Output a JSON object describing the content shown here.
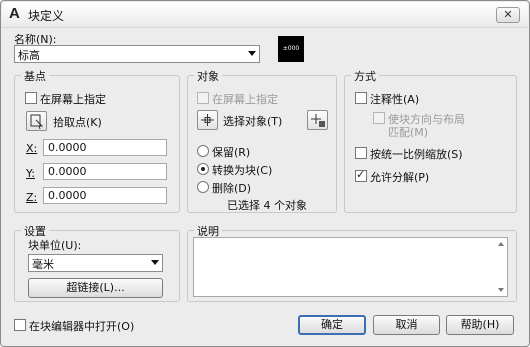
{
  "window": {
    "title": "块定义",
    "app_icon": "A",
    "close_label": "✕"
  },
  "name": {
    "label": "名称(N):",
    "value": "标高",
    "preview_text": "±000"
  },
  "base_point": {
    "title": "基点",
    "specify_on_screen": "在屏幕上指定",
    "pick_point": "拾取点(K)",
    "x_label": "X:",
    "x_value": "0.0000",
    "y_label": "Y:",
    "y_value": "0.0000",
    "z_label": "Z:",
    "z_value": "0.0000"
  },
  "objects": {
    "title": "对象",
    "specify_on_screen": "在屏幕上指定",
    "select_objects": "选择对象(T)",
    "retain": "保留(R)",
    "convert_to_block": "转换为块(C)",
    "delete": "删除(D)",
    "selected_count": "已选择 4 个对象"
  },
  "behavior": {
    "title": "方式",
    "annotative": "注释性(A)",
    "match_orientation_line1": "使块方向与布局",
    "match_orientation_line2": "匹配(M)",
    "scale_uniformly": "按统一比例缩放(S)",
    "allow_exploding": "允许分解(P)"
  },
  "settings": {
    "title": "设置",
    "block_unit_label": "块单位(U):",
    "block_unit_value": "毫米",
    "hyperlink": "超链接(L)..."
  },
  "description": {
    "title": "说明"
  },
  "footer": {
    "open_in_editor": "在块编辑器中打开(O)",
    "ok": "确定",
    "cancel": "取消",
    "help": "帮助(H)"
  }
}
